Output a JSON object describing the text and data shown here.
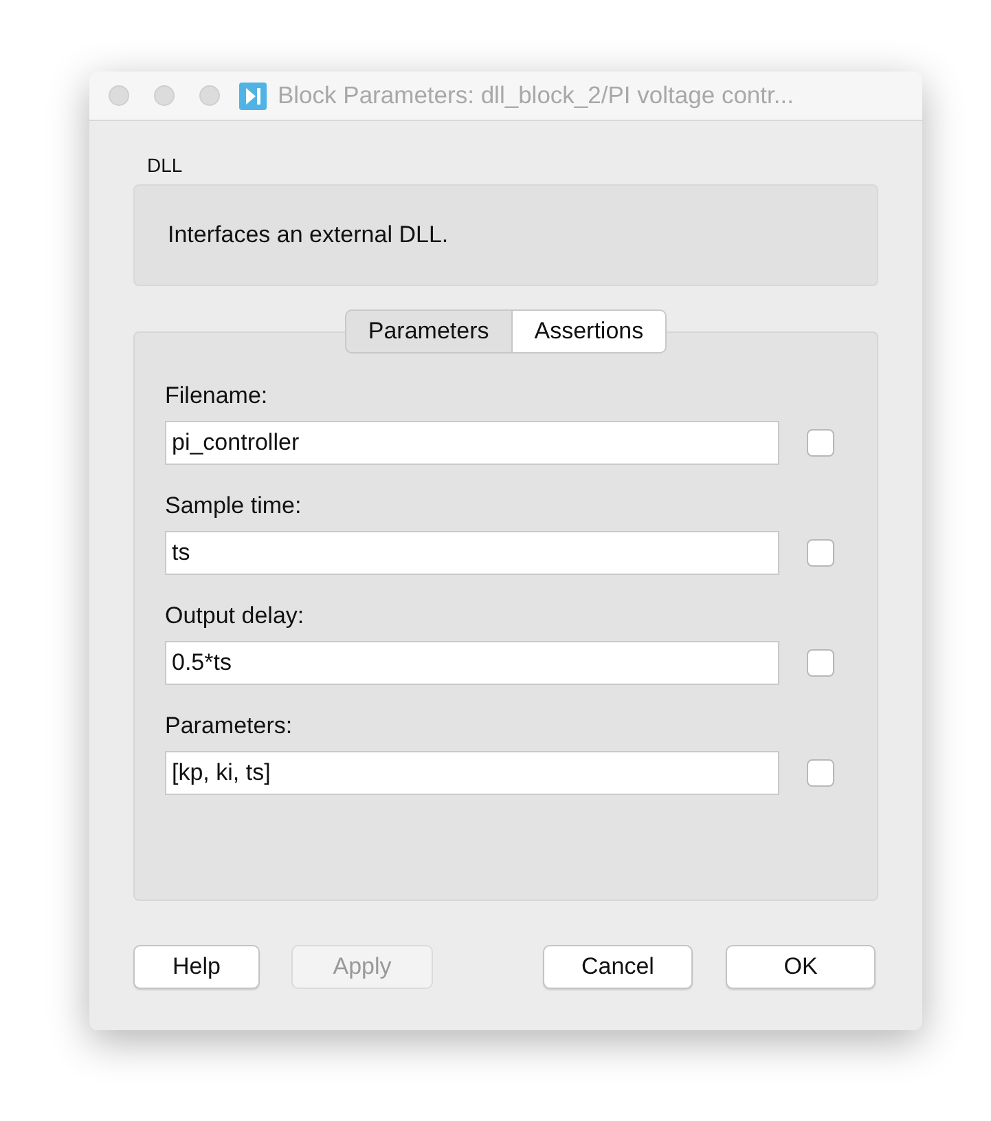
{
  "window": {
    "title": "Block Parameters: dll_block_2/PI voltage contr..."
  },
  "block": {
    "name": "DLL",
    "description": "Interfaces an external DLL."
  },
  "tabs": [
    {
      "label": "Parameters",
      "selected": true
    },
    {
      "label": "Assertions",
      "selected": false
    }
  ],
  "fields": [
    {
      "label": "Filename:",
      "value": "pi_controller",
      "checked": false
    },
    {
      "label": "Sample time:",
      "value": "ts",
      "checked": false
    },
    {
      "label": "Output delay:",
      "value": "0.5*ts",
      "checked": false
    },
    {
      "label": "Parameters:",
      "value": "[kp, ki, ts]",
      "checked": false
    }
  ],
  "buttons": [
    {
      "label": "Help",
      "disabled": false
    },
    {
      "label": "Apply",
      "disabled": true
    },
    {
      "label": "Cancel",
      "disabled": false
    },
    {
      "label": "OK",
      "disabled": false
    }
  ]
}
